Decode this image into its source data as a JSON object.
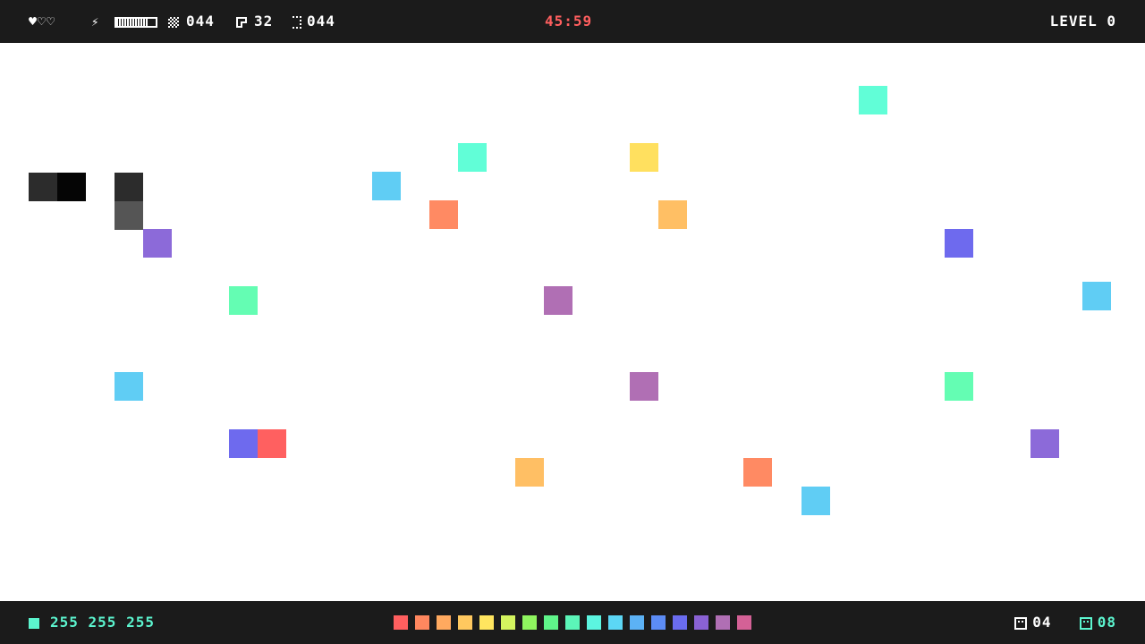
{
  "hud": {
    "hearts": [
      "♥",
      "♡",
      "♡"
    ],
    "energy_level": 0.8,
    "stat_pattern": "044",
    "stat_pick": "32",
    "stat_bracket": "044",
    "timer": "45:59",
    "level_label": "LEVEL 0",
    "timer_color": "#ff5f5f"
  },
  "world": {
    "background": "#ffffff",
    "player_color": "#1c1c1c",
    "blocks_colors": {
      "teal": "#61fed7",
      "yellow": "#ffe05f",
      "sky": "#60cdf4",
      "orange": "#ff8a63",
      "amber": "#ffbf64",
      "indigo": "#6e6aee",
      "violet": "#8c6ad9",
      "mint": "#64fdb3",
      "mauve": "#b06fb4",
      "red": "#ff6060",
      "dark": "#2c2c2c",
      "gray": "#555555",
      "black": "#050505"
    }
  },
  "footer": {
    "rgb_readout": "255 255 255",
    "current_color": "#5cf5cf",
    "palette": [
      "#ff5f5f",
      "#ff875f",
      "#ffa95f",
      "#ffc85f",
      "#ffe55f",
      "#d4f55f",
      "#8ff55f",
      "#5ff58a",
      "#5cf5b8",
      "#5cf5e0",
      "#5cd7f5",
      "#5cb2f5",
      "#5c8cf5",
      "#6a6cf0",
      "#8a62d4",
      "#b06fb4",
      "#d46196"
    ],
    "lives_count": "04",
    "items_count": "08"
  }
}
